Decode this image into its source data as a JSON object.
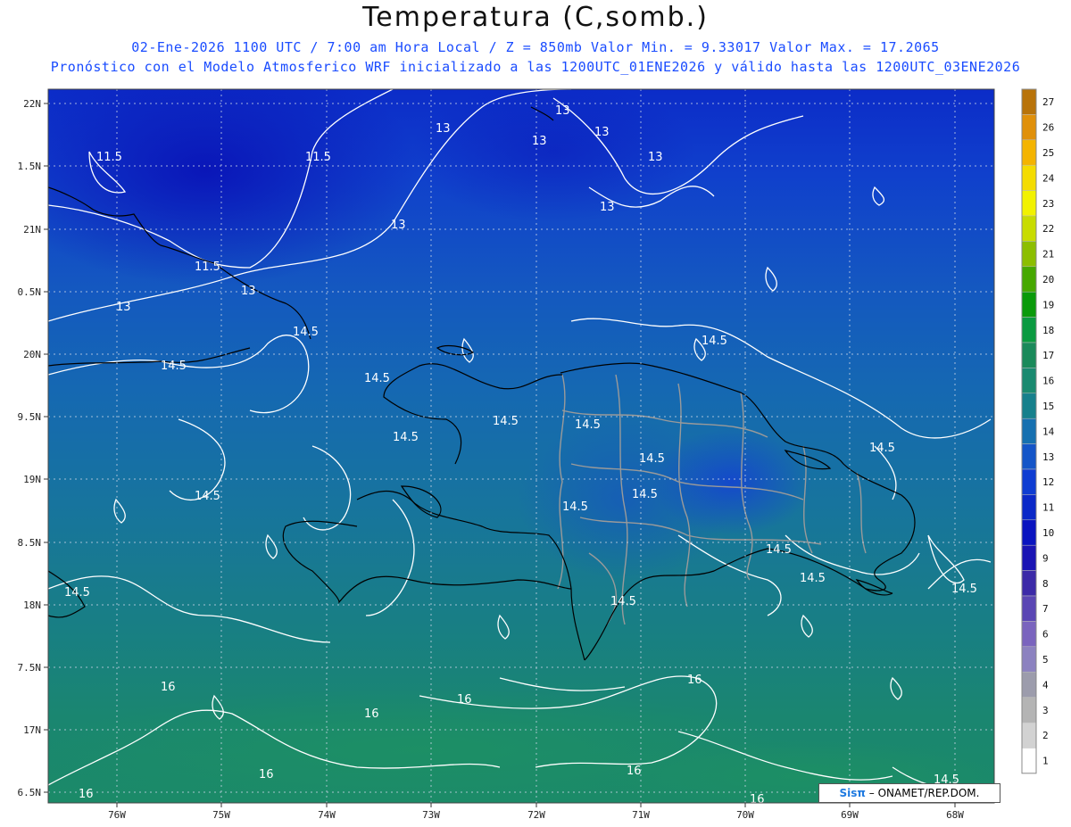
{
  "title": "Temperatura (C,somb.)",
  "subtitle_line1": "02-Ene-2026  1100 UTC / 7:00 am Hora Local / Z = 850mb    Valor Min. = 9.33017  Valor Max. = 17.2065",
  "subtitle_line2": "Pronóstico con el Modelo Atmosferico WRF inicializado a las 1200UTC_01ENE2026 y válido hasta las  1200UTC_03ENE2026",
  "credit": {
    "logo": "Sisπ",
    "text": "– ONAMET/REP.DOM."
  },
  "axes": {
    "lon_labels": [
      "76W",
      "75W",
      "74W",
      "73W",
      "72W",
      "71W",
      "70W",
      "69W",
      "68W"
    ],
    "lat_labels": [
      "22N",
      "1.5N",
      "21N",
      "0.5N",
      "20N",
      "9.5N",
      "19N",
      "8.5N",
      "18N",
      "7.5N",
      "17N",
      "6.5N"
    ]
  },
  "colorbar": {
    "labels": [
      "27",
      "26",
      "25",
      "24",
      "23",
      "22",
      "21",
      "20",
      "19",
      "18",
      "17",
      "16",
      "15",
      "14",
      "13",
      "12",
      "11",
      "10",
      "9",
      "8",
      "7",
      "6",
      "5",
      "4",
      "3",
      "2",
      "1"
    ],
    "colors": [
      "#b8730a",
      "#e0900a",
      "#f4b400",
      "#f4dc00",
      "#f2f200",
      "#c8dc00",
      "#8cbe00",
      "#46a800",
      "#0a9a0a",
      "#0a9a40",
      "#1a8a5a",
      "#1a8a70",
      "#16808c",
      "#1670b0",
      "#1455c8",
      "#0e3cd2",
      "#0a28c8",
      "#0a14c0",
      "#1a14b4",
      "#3c2aa8",
      "#5a46b4",
      "#7a64be",
      "#8c82c0",
      "#9c9cac",
      "#b4b4b4",
      "#d2d2d2",
      "#ffffff"
    ]
  },
  "contour_labels": [
    "11.5",
    "11.5",
    "11.5",
    "13",
    "13",
    "13",
    "13",
    "13",
    "13",
    "13",
    "14.5",
    "14.5",
    "14.5",
    "14.5",
    "14.5",
    "14.5",
    "14.5",
    "14.5",
    "14.5",
    "14.5",
    "14.5",
    "14.5",
    "14.5",
    "14.5",
    "14.5",
    "16",
    "16",
    "16",
    "16",
    "16",
    "16",
    "16",
    "16"
  ],
  "colors": {
    "title": "#111111",
    "subtitle": "#1a4cff",
    "contour": "#ffffff",
    "coast": "#000000",
    "borders": "#999999"
  }
}
